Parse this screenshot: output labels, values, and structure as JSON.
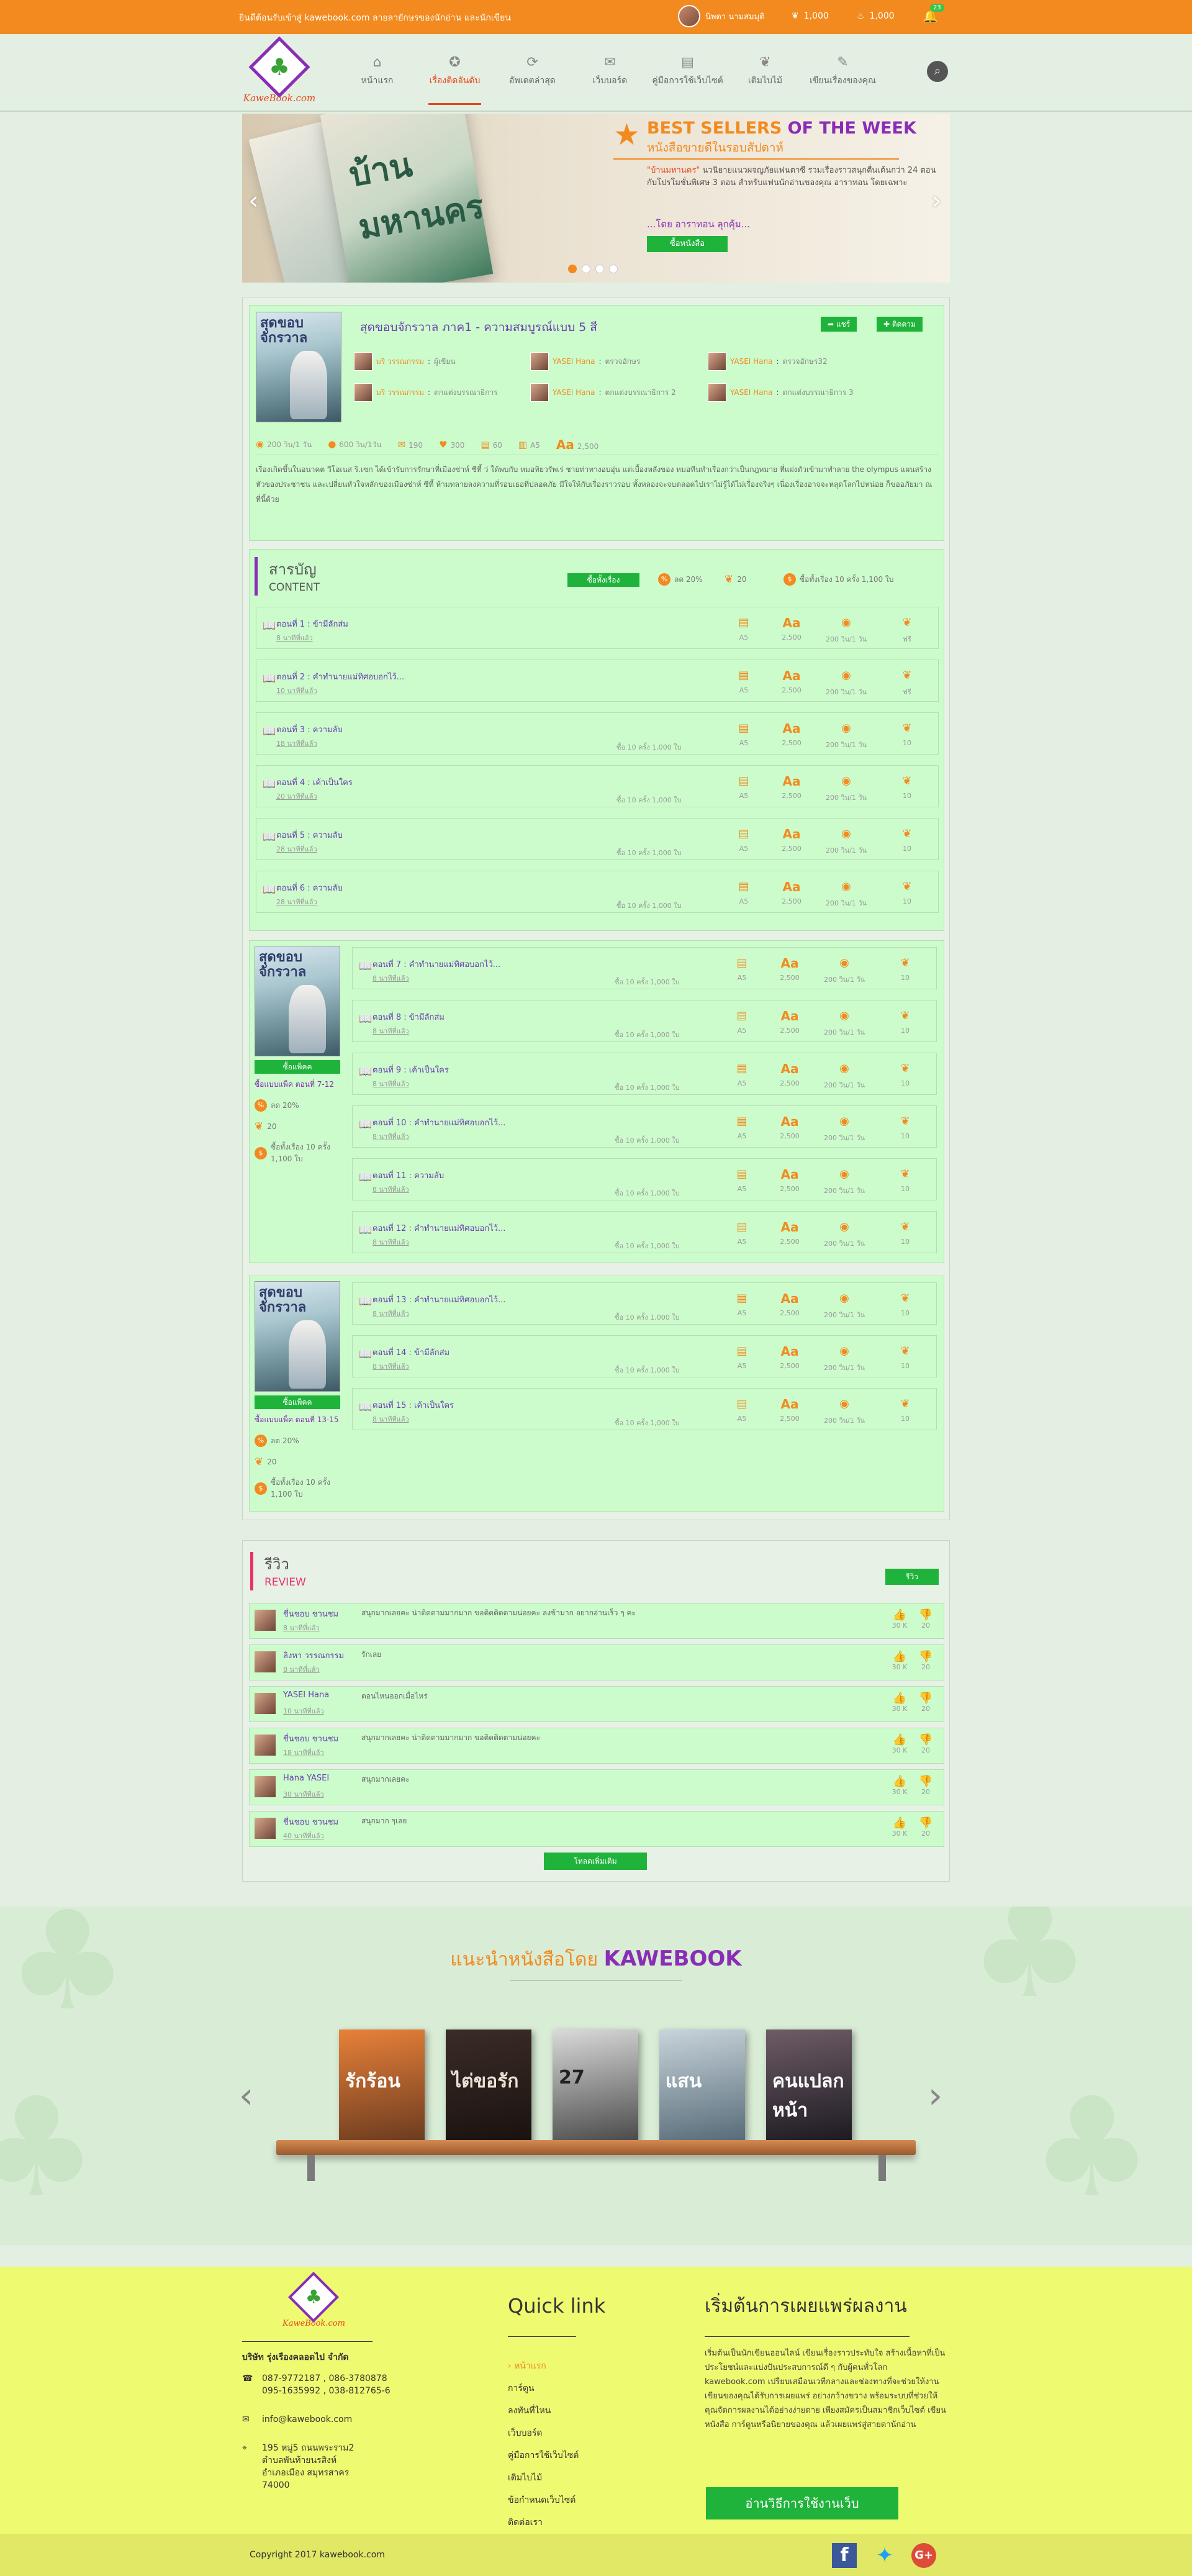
{
  "topbar": {
    "tagline": "ยินดีต้อนรับเข้าสู่ kawebook.com ลายลายักษรของนักอ่าน และนักเขียน",
    "username": "นิพดา นามสมมุติ",
    "coins": "1,000",
    "points": "1,000",
    "notifications": "23"
  },
  "logo": {
    "brand": "KaweBook.com"
  },
  "nav": {
    "items": [
      {
        "label": "หน้าแรก",
        "icon": "home-icon"
      },
      {
        "label": "เรื่องติดอันดับ",
        "icon": "award-icon"
      },
      {
        "label": "อัพเดตล่าสุด",
        "icon": "refresh-icon"
      },
      {
        "label": "เว็บบอร์ด",
        "icon": "chat-icon"
      },
      {
        "label": "คู่มือการใช้เว็บไซต์",
        "icon": "book-icon"
      },
      {
        "label": "เติมไบไม้",
        "icon": "leaf-icon"
      },
      {
        "label": "เขียนเรื่องของคุณ",
        "icon": "pen-icon"
      }
    ]
  },
  "banner": {
    "cover_title": "บ้านมหานคร",
    "heading_orange": "BEST SELLERS",
    "heading_purple": "OF THE WEEK",
    "subheading": "หนังสือขายดีในรอบสัปดาห์",
    "desc_highlight": "\"บ้านมหานคร\"",
    "desc": "นวนิยายแนวผจญภัยแฟนตาซี รวมเรื่องราวสนุกตื่นเต้นกว่า 24 ตอน กับโปรโมชั่นพิเศษ 3 ตอน สำหรับแฟนนักอ่านของคุณ อาราทอน โดยเฉพาะ",
    "author": "...โดย อาราทอน ลุกคุ้ม...",
    "button": "ซื้อหนังสือ"
  },
  "story": {
    "cover_title": "สุดขอบจักรวาล",
    "title": "สุดขอบจักรวาล ภาค1 - ความสมบูรณ์แบบ 5 สี",
    "share_label": "แชร์",
    "follow_label": "ติดตาม",
    "credits": [
      {
        "name": "มริ วรรณกรรม",
        "role": "ผู้เขียน"
      },
      {
        "name": "YASEI Hana",
        "role": "ตรวจอักษร"
      },
      {
        "name": "YASEI Hana",
        "role": "ตรวจอักษร32"
      },
      {
        "name": "มริ วรรณกรรม",
        "role": "ตกแต่งบรรณาธิการ"
      },
      {
        "name": "YASEI Hana",
        "role": "ตกแต่งบรรณาธิการ 2"
      },
      {
        "name": "YASEI Hana",
        "role": "ตกแต่งบรรณาธิการ 3"
      }
    ],
    "stats": [
      {
        "icon": "eye-icon",
        "value": "200 วิน/1 วัน"
      },
      {
        "icon": "coin-icon",
        "value": "600 วิน/1วัน"
      },
      {
        "icon": "comment-icon",
        "value": "190"
      },
      {
        "icon": "heart-icon",
        "value": "300"
      },
      {
        "icon": "page-icon",
        "value": "60"
      },
      {
        "icon": "doc-icon",
        "value": "A5"
      },
      {
        "icon": "font-size-icon",
        "value": "2,500"
      }
    ],
    "synopsis": "เรื่องเกิดขึ้นในอนาคต วีโอเนส ริ.เซก ได้เข้ารับการรักษาที่เมืองซ่าห์ ซีที้ ว่ ใด้พบกับ หมอทิยวรัพเร่ ชายท่าทางอบอุ่น แต่เบื้องหลังของ หมอทีนทำเรื่องกว่าเป็นกฎหมาย ที่แฝงตัวเข้ามาทำลาย the olympus แผนสร้างหัวของประชาชน และเปลี่ยนหัวใจหลักของเมืองซ่าห์ ซีที้ ห้ามทลายลงความที่รอบเธอที่ปลอดภัย มีใจให้กับเรื่องราวรอบ ทั้งหลองจะจบตลอดไปเราไม่รู้ได้ไม่เรื่องจริงๆ เนื่องเรื่องอาจจะหลุดโลกไปหน่อย ก็ขออภัยมา ณ ที่นี้ด้วย"
  },
  "content": {
    "title_th": "สารบัญ",
    "title_en": "CONTENT",
    "buy_all_label": "ซื้อทั้งเรื่อง",
    "discount": "ลด 20%",
    "leaves": "20",
    "coins_note": "ซื้อทั้งเรื่อง 10 ครั้ง 1,100 ใบ",
    "episodes": [
      {
        "title": "ตอนที่ 1 : ข้ามีลักส่ม",
        "time": "8 นาทีที่แล้ว",
        "price": "",
        "pages": "A5",
        "chars": "2,500",
        "views": "200 วิน/1 วัน",
        "cost": "ฟรี"
      },
      {
        "title": "ตอนที่ 2 : คำทำนายแม่ทิศอบอกไว้...",
        "time": "10 นาทีที่แล้ว",
        "price": "",
        "pages": "A5",
        "chars": "2,500",
        "views": "200 วิน/1 วัน",
        "cost": "ฟรี"
      },
      {
        "title": "ตอนที่ 3 : ความลับ",
        "time": "18 นาทีที่แล้ว",
        "price": "ซื้อ 10 ครั้ง 1,000 ใบ",
        "pages": "A5",
        "chars": "2,500",
        "views": "200 วิน/1 วัน",
        "cost": "10"
      },
      {
        "title": "ตอนที่ 4 : เค้าเป็นใคร",
        "time": "20 นาทีที่แล้ว",
        "price": "ซื้อ 10 ครั้ง 1,000 ใบ",
        "pages": "A5",
        "chars": "2,500",
        "views": "200 วิน/1 วัน",
        "cost": "10"
      },
      {
        "title": "ตอนที่ 5 : ความลับ",
        "time": "28 นาทีที่แล้ว",
        "price": "ซื้อ 10 ครั้ง 1,000 ใบ",
        "pages": "A5",
        "chars": "2,500",
        "views": "200 วิน/1 วัน",
        "cost": "10"
      },
      {
        "title": "ตอนที่ 6 : ความลับ",
        "time": "28 นาทีที่แล้ว",
        "price": "ซื้อ 10 ครั้ง 1,000 ใบ",
        "pages": "A5",
        "chars": "2,500",
        "views": "200 วิน/1 วัน",
        "cost": "10"
      }
    ]
  },
  "packages": [
    {
      "cover_title": "สุดขอบจักรวาล",
      "buy_label": "ซื้อแพ็คค",
      "pack_name": "ซื้อแบบแพ็ค ตอนที่ 7-12",
      "discount": "ลด 20%",
      "leaves": "20",
      "coins_note": "ซื้อทั้งเรื่อง 10 ครั้ง 1,100 ใบ",
      "episodes": [
        {
          "title": "ตอนที่ 7 : คำทำนายแม่ทิศอบอกไว้...",
          "time": "8 นาทีที่แล้ว",
          "price": "ซื้อ 10 ครั้ง 1,000 ใบ",
          "pages": "A5",
          "chars": "2,500",
          "views": "200 วิน/1 วัน",
          "cost": "10"
        },
        {
          "title": "ตอนที่ 8 : ข้ามีลักส่ม",
          "time": "8 นาทีที่แล้ว",
          "price": "ซื้อ 10 ครั้ง 1,000 ใบ",
          "pages": "A5",
          "chars": "2,500",
          "views": "200 วิน/1 วัน",
          "cost": "10"
        },
        {
          "title": "ตอนที่ 9 : เค้าเป็นใคร",
          "time": "8 นาทีที่แล้ว",
          "price": "ซื้อ 10 ครั้ง 1,000 ใบ",
          "pages": "A5",
          "chars": "2,500",
          "views": "200 วิน/1 วัน",
          "cost": "10"
        },
        {
          "title": "ตอนที่ 10 : คำทำนายแม่ทิศอบอกไว้...",
          "time": "8 นาทีที่แล้ว",
          "price": "ซื้อ 10 ครั้ง 1,000 ใบ",
          "pages": "A5",
          "chars": "2,500",
          "views": "200 วิน/1 วัน",
          "cost": "10"
        },
        {
          "title": "ตอนที่ 11 : ความลับ",
          "time": "8 นาทีที่แล้ว",
          "price": "ซื้อ 10 ครั้ง 1,000 ใบ",
          "pages": "A5",
          "chars": "2,500",
          "views": "200 วิน/1 วัน",
          "cost": "10"
        },
        {
          "title": "ตอนที่ 12 : คำทำนายแม่ทิศอบอกไว้...",
          "time": "8 นาทีที่แล้ว",
          "price": "ซื้อ 10 ครั้ง 1,000 ใบ",
          "pages": "A5",
          "chars": "2,500",
          "views": "200 วิน/1 วัน",
          "cost": "10"
        }
      ]
    },
    {
      "cover_title": "สุดขอบจักรวาล",
      "buy_label": "ซื้อแพ็คค",
      "pack_name": "ซื้อแบบแพ็ค ตอนที่ 13-15",
      "discount": "ลด 20%",
      "leaves": "20",
      "coins_note": "ซื้อทั้งเรื่อง 10 ครั้ง 1,100 ใบ",
      "episodes": [
        {
          "title": "ตอนที่ 13 : คำทำนายแม่ทิศอบอกไว้...",
          "time": "8 นาทีที่แล้ว",
          "price": "ซื้อ 10 ครั้ง 1,000 ใบ",
          "pages": "A5",
          "chars": "2,500",
          "views": "200 วิน/1 วัน",
          "cost": "10"
        },
        {
          "title": "ตอนที่ 14 : ข้ามีลักส่ม",
          "time": "8 นาทีที่แล้ว",
          "price": "ซื้อ 10 ครั้ง 1,000 ใบ",
          "pages": "A5",
          "chars": "2,500",
          "views": "200 วิน/1 วัน",
          "cost": "10"
        },
        {
          "title": "ตอนที่ 15 : เค้าเป็นใคร",
          "time": "8 นาทีที่แล้ว",
          "price": "ซื้อ 10 ครั้ง 1,000 ใบ",
          "pages": "A5",
          "chars": "2,500",
          "views": "200 วิน/1 วัน",
          "cost": "10"
        }
      ]
    }
  ],
  "reviews": {
    "title_th": "รีวิว",
    "title_en": "REVIEW",
    "write_label": "รีวิว",
    "more_label": "โหลดเพิ่มเติม",
    "items": [
      {
        "name": "ชื่นชอบ ชวนชม",
        "time": "8 นาทีที่แล้ว",
        "text": "สนุกมากเลยคะ น่าติดตามมากมาก ขอติดติดตามน่อยคะ ลงข้ามาก อยากอ่านเร็ว ๆ คะ",
        "likes": "30 K",
        "dislikes": "20"
      },
      {
        "name": "ลิงหา วรรณกรรม",
        "time": "8 นาทีที่แล้ว",
        "text": "รักเลย",
        "likes": "30 K",
        "dislikes": "20"
      },
      {
        "name": "YASEI Hana",
        "time": "10 นาทีที่แล้ว",
        "text": "ตอนไหนออกเมื่อไหร่",
        "likes": "30 K",
        "dislikes": "20"
      },
      {
        "name": "ชื่นชอบ ชวนชม",
        "time": "18 นาทีที่แล้ว",
        "text": "สนุกมากเลยคะ น่าติดตามมากมาก ขอติดติดตามน่อยคะ",
        "likes": "30 K",
        "dislikes": "20"
      },
      {
        "name": "Hana YASEI",
        "time": "30 นาทีที่แล้ว",
        "text": "สนุกมากเลยคะ",
        "likes": "30 K",
        "dislikes": "20"
      },
      {
        "name": "ชื่นชอบ ชวนชม",
        "time": "40 นาทีที่แล้ว",
        "text": "สนุกมาก ๆเลย",
        "likes": "30 K",
        "dislikes": "20"
      }
    ]
  },
  "recommend": {
    "prefix": "แนะนำหนังสือโดย",
    "brand": "KAWEBOOK",
    "books": [
      {
        "title": "รักร้อน",
        "color1": "#e8813a",
        "color2": "#6b3b1f",
        "text": "#fff"
      },
      {
        "title": "ไต่ขอรัก",
        "color1": "#3a2c26",
        "color2": "#1a1210",
        "text": "#e9e3d6"
      },
      {
        "title": "27",
        "color1": "#dadada",
        "color2": "#4a4a4a",
        "text": "#222"
      },
      {
        "title": "แสน",
        "color1": "#c9d4db",
        "color2": "#566b78",
        "text": "#fff"
      },
      {
        "title": "คนแปลกหน้า",
        "color1": "#6e5c66",
        "color2": "#1c1a22",
        "text": "#fff"
      }
    ]
  },
  "footer": {
    "brand": "KaweBook.com",
    "company": "บริษัท รุ่งเรืองคลอดไป จำกัด",
    "phone1": "087-9772187 , 086-3780878",
    "phone2": "095-1635992 , 038-812765-6",
    "email": "info@kawebook.com",
    "address": [
      "195 หมู่5 ถนนพระราม2",
      "ตำบลพันท้ายนรสิงห์",
      "อำเภอเมือง สมุทรสาคร",
      "74000"
    ],
    "quicklink_title": "Quick link",
    "links": [
      "หน้าแรก",
      "การ์ตูน",
      "ลงทันที่ไหน",
      "เว็บบอร์ด",
      "คู่มือการใช้เว็บไซต์",
      "เติมไบไม้",
      "ข้อกำหนดเว็บไซต์",
      "ติดต่อเรา"
    ],
    "start_title": "เริ่มต้นการเผยแพร่ผลงาน",
    "start_text": "เริ่มต้นเป็นนักเขียนออนไลน์ เขียนเรื่องราวประทับใจ สร้างเนื้อหาที่เป็นประโยชน์และแบ่งปันประสบการณ์ดี ๆ กับผู้คนทั่วโลก kawebook.com เปรียบเสมือนเวทีกลางและช่องทางที่จะช่วยให้งานเขียนของคุณได้รับการเผยแพร่ อย่างกว้างขวาง พร้อมระบบที่ช่วยให้คุณจัดการผลงานได้อย่างง่ายดาย เพียงสมัครเป็นสมาชิกเว็บไซต์ เขียนหนังสือ การ์ตูนหรือนิยายของคุณ แล้วเผยแพร่สู่สายตานักอ่าน",
    "cta": "อ่านวิธีการใช้งานเว็บ",
    "copyright": "Copyright 2017 kawebook.com"
  },
  "colors": {
    "orange": "#f28a1f",
    "purple": "#8a2db6",
    "green": "#1fb33b",
    "pink": "#e6346a"
  }
}
